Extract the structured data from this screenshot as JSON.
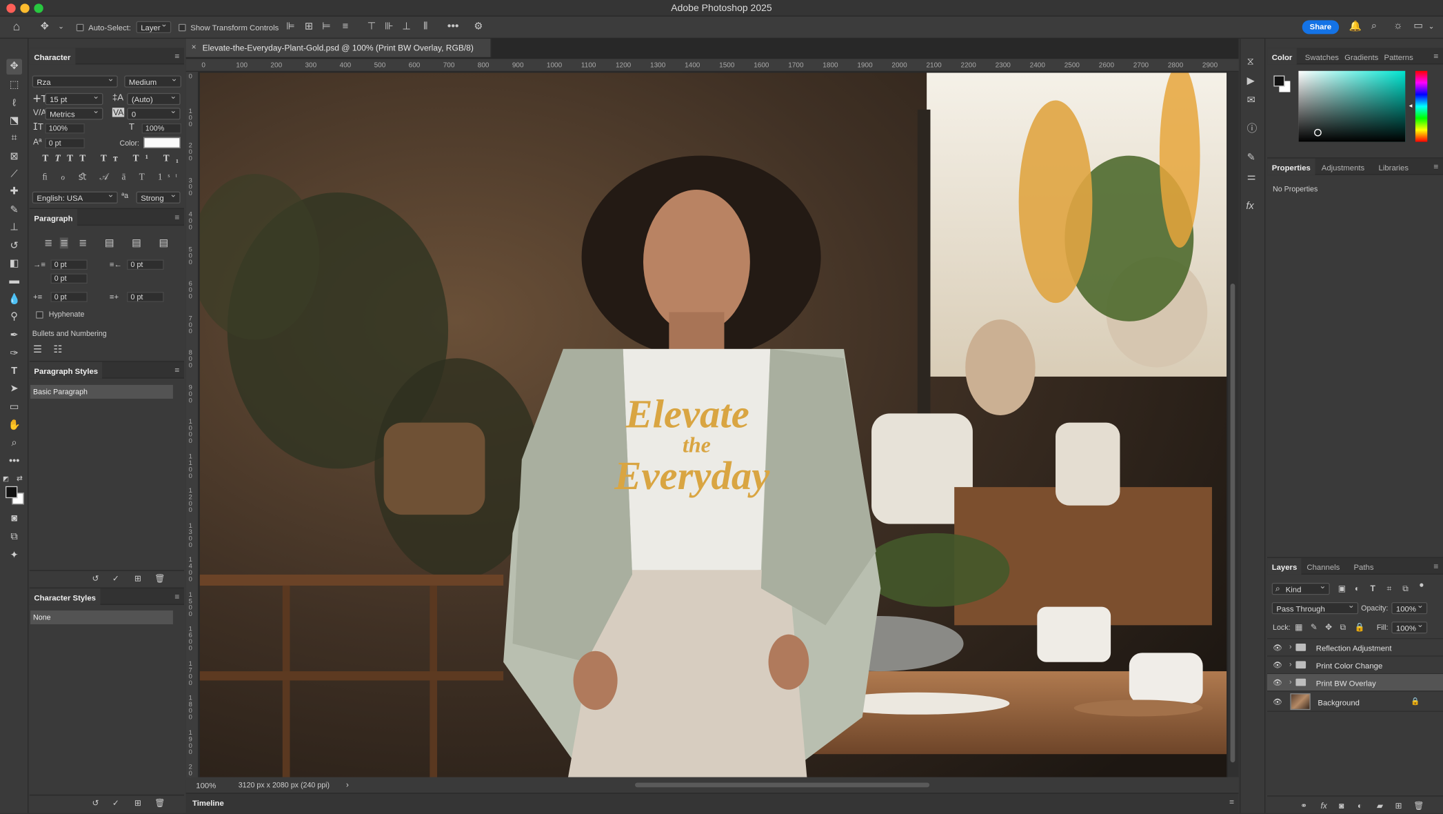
{
  "window": {
    "title": "Adobe Photoshop 2025"
  },
  "options_bar": {
    "auto_select_label": "Auto-Select:",
    "auto_select_value": "Layer",
    "show_transform_label": "Show Transform Controls",
    "share_label": "Share"
  },
  "document": {
    "tab_title": "Elevate-the-Everyday-Plant-Gold.psd @ 100% (Print BW Overlay, RGB/8)",
    "zoom": "100%",
    "info": "3120 px x 2080 px (240 ppi)",
    "ruler_top": [
      "0",
      "100",
      "200",
      "300",
      "400",
      "500",
      "600",
      "700",
      "800",
      "900",
      "1000",
      "1100",
      "1200",
      "1300",
      "1400",
      "1500",
      "1600",
      "1700",
      "1800",
      "1900",
      "2000",
      "2100",
      "2200",
      "2300",
      "2400",
      "2500",
      "2600",
      "2700",
      "2800",
      "2900"
    ],
    "ruler_left": [
      "0",
      "100",
      "200",
      "300",
      "400",
      "500",
      "600",
      "700",
      "800",
      "900",
      "1000",
      "1100",
      "1200",
      "1300",
      "1400",
      "1500",
      "1600",
      "1700",
      "1800",
      "1900",
      "2000"
    ],
    "shirt_text": [
      "Elevate",
      "the",
      "Everyday"
    ]
  },
  "character": {
    "title": "Character",
    "font_family": "Rza",
    "font_style": "Medium",
    "size": "15 pt",
    "leading": "(Auto)",
    "kerning": "Metrics",
    "tracking": "0",
    "vscale": "100%",
    "hscale": "100%",
    "baseline": "0 pt",
    "color_label": "Color:",
    "language": "English: USA",
    "antialias": "Strong"
  },
  "paragraph": {
    "title": "Paragraph",
    "indent_left": "0 pt",
    "indent_right": "0 pt",
    "indent_first": "0 pt",
    "space_before": "0 pt",
    "space_after": "0 pt",
    "hyphenate": "Hyphenate",
    "bullets": "Bullets and Numbering"
  },
  "paragraph_styles": {
    "title": "Paragraph Styles",
    "item": "Basic Paragraph"
  },
  "character_styles": {
    "title": "Character Styles",
    "item": "None"
  },
  "color_panel": {
    "tabs": [
      "Color",
      "Swatches",
      "Gradients",
      "Patterns"
    ]
  },
  "properties_panel": {
    "tabs": [
      "Properties",
      "Adjustments",
      "Libraries"
    ],
    "content": "No Properties"
  },
  "layers_panel": {
    "tabs": [
      "Layers",
      "Channels",
      "Paths"
    ],
    "kind": "Kind",
    "blend_mode": "Pass Through",
    "opacity_label": "Opacity:",
    "opacity": "100%",
    "lock_label": "Lock:",
    "fill_label": "Fill:",
    "fill": "100%",
    "layers": [
      {
        "name": "Reflection Adjustment",
        "type": "group"
      },
      {
        "name": "Print Color Change",
        "type": "group"
      },
      {
        "name": "Print BW Overlay",
        "type": "group",
        "selected": true
      },
      {
        "name": "Background",
        "type": "image"
      }
    ]
  },
  "timeline": {
    "label": "Timeline"
  },
  "colors": {
    "accent": "#1473e6",
    "panel": "#3a3a3a",
    "shirt_gold": "#d9a542"
  }
}
